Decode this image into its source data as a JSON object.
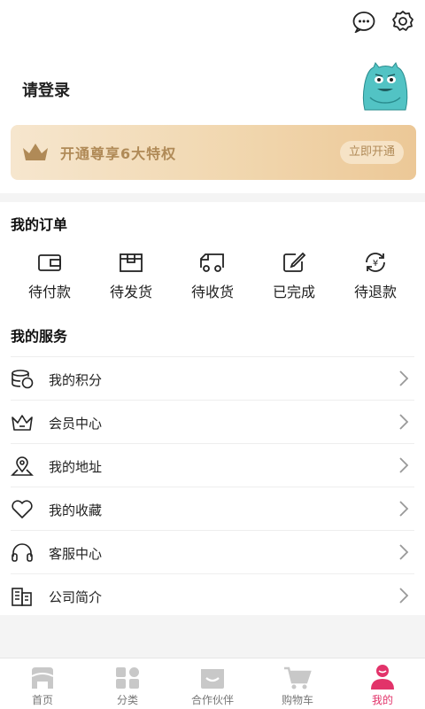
{
  "header": {
    "icons": [
      "more-chat-icon",
      "settings-gear-icon"
    ]
  },
  "profile": {
    "login_text": "请登录",
    "vip_banner": {
      "text": "开通尊享6大特权",
      "button": "立即开通"
    }
  },
  "orders": {
    "title": "我的订单",
    "items": [
      {
        "label": "待付款",
        "icon": "wallet-icon"
      },
      {
        "label": "待发货",
        "icon": "package-icon"
      },
      {
        "label": "待收货",
        "icon": "delivery-truck-icon"
      },
      {
        "label": "已完成",
        "icon": "edit-done-icon"
      },
      {
        "label": "待退款",
        "icon": "refund-yen-icon"
      }
    ]
  },
  "services": {
    "title": "我的服务",
    "items": [
      {
        "label": "我的积分",
        "icon": "coins-icon"
      },
      {
        "label": "会员中心",
        "icon": "crown-icon"
      },
      {
        "label": "我的地址",
        "icon": "location-pin-icon"
      },
      {
        "label": "我的收藏",
        "icon": "heart-icon"
      },
      {
        "label": "客服中心",
        "icon": "headset-icon"
      },
      {
        "label": "公司简介",
        "icon": "building-icon"
      }
    ]
  },
  "tabbar": {
    "items": [
      {
        "label": "首页",
        "icon": "home-icon"
      },
      {
        "label": "分类",
        "icon": "category-grid-icon"
      },
      {
        "label": "合作伙伴",
        "icon": "partner-icon"
      },
      {
        "label": "购物车",
        "icon": "cart-icon"
      },
      {
        "label": "我的",
        "icon": "user-icon"
      }
    ],
    "active": "我的"
  },
  "colors": {
    "accent": "#e2336a",
    "vip_text": "#b08a57",
    "vip_bg": "#f1d7af",
    "avatar": "#52c3c4"
  }
}
